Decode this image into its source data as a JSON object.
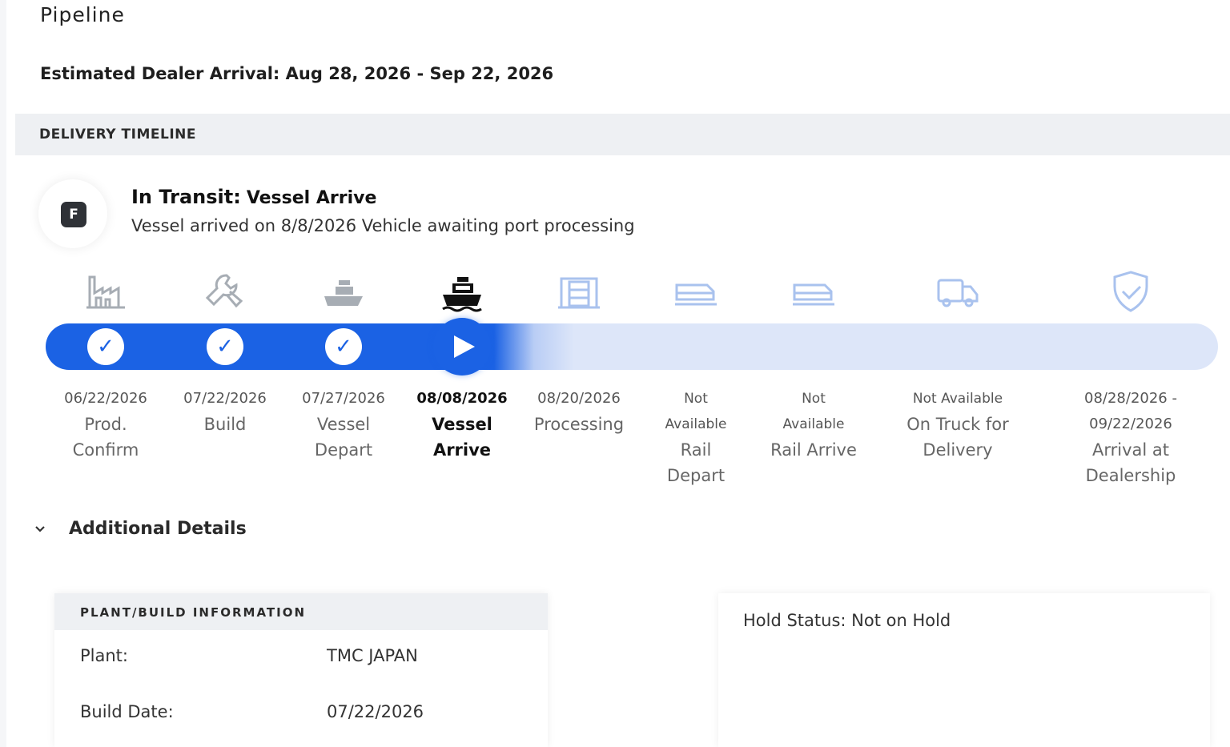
{
  "page": {
    "title": "Pipeline",
    "estimated_arrival": "Estimated Dealer Arrival: Aug 28, 2026 - Sep 22, 2026"
  },
  "delivery_timeline": {
    "section_title": "DELIVERY TIMELINE",
    "status_badge_letter": "F",
    "status_prefix": "In Transit:",
    "status_stage": "Vessel Arrive",
    "status_description": "Vessel arrived on 8/8/2026 Vehicle awaiting port processing",
    "accent_color": "#1b62e4",
    "steps": [
      {
        "date": "06/22/2026",
        "label": "Prod. Confirm",
        "state": "complete",
        "icon": "factory-icon"
      },
      {
        "date": "07/22/2026",
        "label": "Build",
        "state": "complete",
        "icon": "wrench-icon"
      },
      {
        "date": "07/27/2026",
        "label": "Vessel Depart",
        "state": "complete",
        "icon": "ship-depart-icon"
      },
      {
        "date": "08/08/2026",
        "label": "Vessel Arrive",
        "state": "current",
        "icon": "ship-arrive-icon"
      },
      {
        "date": "08/20/2026",
        "label": "Processing",
        "state": "pending",
        "icon": "processing-icon"
      },
      {
        "date": "Not Available",
        "label": "Rail Depart",
        "state": "pending",
        "icon": "rail-depart-icon"
      },
      {
        "date": "Not Available",
        "label": "Rail Arrive",
        "state": "pending",
        "icon": "rail-arrive-icon"
      },
      {
        "date": "Not Available",
        "label": "On Truck for Delivery",
        "state": "pending",
        "icon": "truck-icon"
      },
      {
        "date": "08/28/2026 - 09/22/2026",
        "label": "Arrival at Dealership",
        "state": "pending",
        "icon": "shield-check-icon"
      }
    ]
  },
  "additional_details": {
    "toggle_label": "Additional Details",
    "plant_panel": {
      "title": "PLANT/BUILD INFORMATION",
      "rows": [
        {
          "label": "Plant:",
          "value": "TMC JAPAN"
        },
        {
          "label": "Build Date:",
          "value": "07/22/2026"
        }
      ]
    },
    "hold_status": "Hold Status: Not on Hold"
  }
}
